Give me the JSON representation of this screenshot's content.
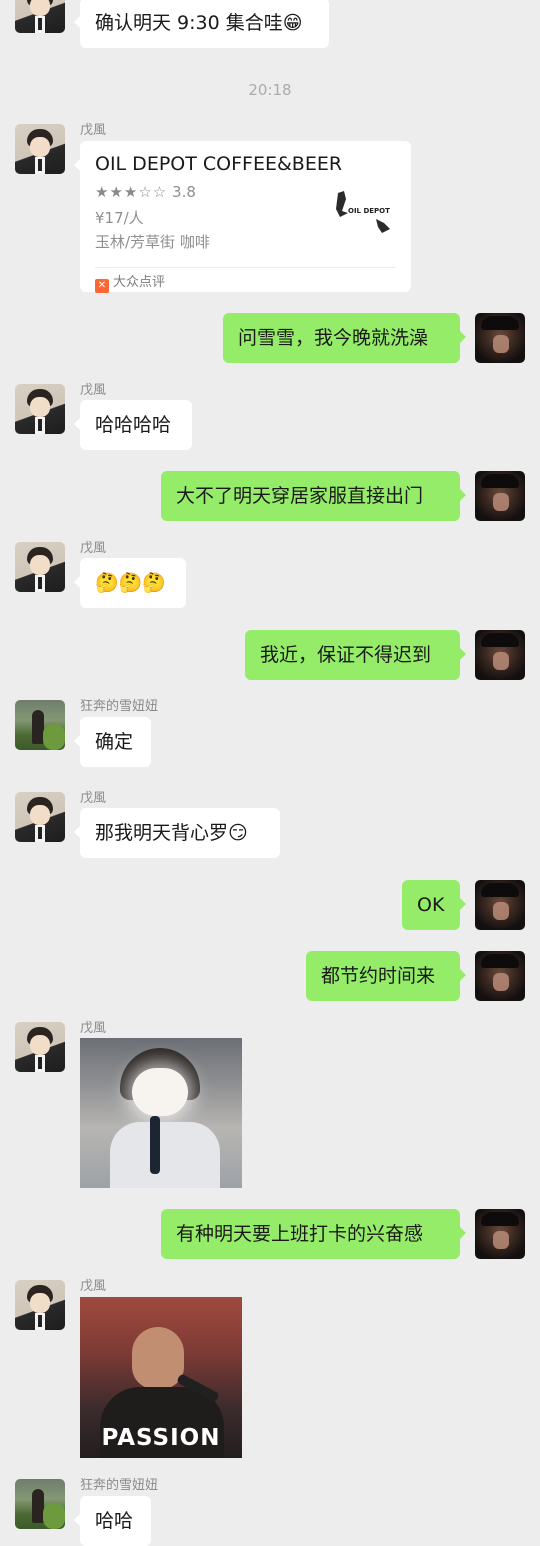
{
  "messages": {
    "m0": {
      "text": "确认明天 9:30 集合哇😁"
    },
    "time1": "20:18",
    "m1": {
      "sender": "戊風",
      "card": {
        "title": "OIL DEPOT COFFEE&BEER",
        "rating_stars": "★★★☆☆",
        "rating": "3.8",
        "price": "¥17/人",
        "location": "玉林/芳草街 咖啡",
        "source": "大众点评",
        "logo_text": "OIL DEPOT"
      }
    },
    "m2": {
      "text": "问雪雪，我今晚就洗澡"
    },
    "m3": {
      "sender": "戊風",
      "text": "哈哈哈哈"
    },
    "m4": {
      "text": "大不了明天穿居家服直接出门"
    },
    "m5": {
      "sender": "戊風",
      "text": "🤔🤔🤔"
    },
    "m6": {
      "text": "我近，保证不得迟到"
    },
    "m7": {
      "sender": "狂奔的雪妞妞",
      "text": "确定"
    },
    "m8": {
      "sender": "戊風",
      "text": "那我明天背心罗😏"
    },
    "m9": {
      "text": "OK"
    },
    "m10": {
      "text": "都节约时间来"
    },
    "m11": {
      "sender": "戊風"
    },
    "m12": {
      "text": "有种明天要上班打卡的兴奋感"
    },
    "m13": {
      "sender": "戊風",
      "image_caption": "PASSION"
    },
    "m14": {
      "sender": "狂奔的雪妞妞",
      "text": "哈哈"
    }
  },
  "colors": {
    "background": "#ededed",
    "incoming_bubble": "#ffffff",
    "outgoing_bubble": "#95ec69"
  }
}
